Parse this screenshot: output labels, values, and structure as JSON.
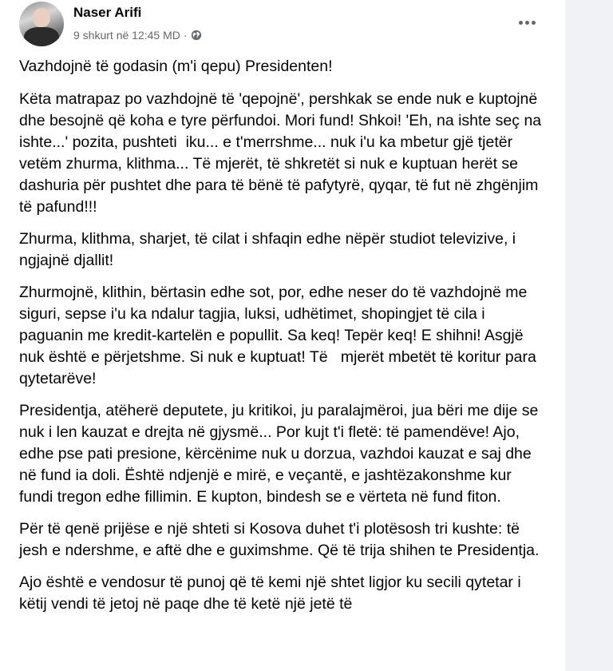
{
  "post": {
    "author": "Naser Arifi",
    "date": "9 shkurt në 12:45 MD",
    "separator": "·",
    "privacy_icon": "globe-icon",
    "more_icon": "more-options-icon",
    "paragraphs": [
      "Vazhdojnë të godasin (m'i qepu) Presidenten!",
      "Këta matrapaz po vazhdojnë të 'qepojnë', pershkak se ende nuk e kuptojnë dhe besojnë që koha e tyre përfundoi. Mori fund! Shkoi! 'Eh, na ishte seç na ishte...' pozita, pushteti  iku... e t'merrshme... nuk i'u ka mbetur gjë tjetër vetëm zhurma, klithma... Të mjerët, të shkretët si nuk e kuptuan herët se dashuria për pushtet dhe para të bënë të pafytyrë, qyqar, të fut në zhgënjim të pafund!!!",
      "Zhurma, klithma, sharjet, të cilat i shfaqin edhe nëpër studiot televizive, i ngjajnë djallit!",
      "Zhurmojnë, klithin, bërtasin edhe sot, por, edhe neser do të vazhdojnë me siguri, sepse i'u ka ndalur tagjia, luksi, udhëtimet, shopingjet të cila i paguanin me kredit-kartelën e popullit. Sa keq! Tepër keq! E shihni! Asgjë nuk është e përjetshme. Si nuk e kuptuat! Të   mjerët mbetët të koritur para qytetarëve!",
      "Presidentja, atëherë deputete, ju kritikoi, ju paralajmëroi, jua bëri me dije se nuk i len kauzat e drejta në gjysmë... Por kujt t'i fletë: të pamendëve! Ajo, edhe pse pati presione, kërcënime nuk u dorzua, vazhdoi kauzat e saj dhe në fund ia doli. Është ndjenjë e mirë, e veçantë, e jashtëzakonshme kur fundi tregon edhe fillimin. E kupton, bindesh se e vërteta në fund fiton.",
      "Për të qenë prijëse e një shteti si Kosova duhet t'i plotësosh tri kushte: të jesh e ndershme, e aftë dhe e guximshme. Që të trija shihen te Presidentja.",
      "Ajo është e vendosur të punoj që të kemi një shtet ligjor ku secili qytetar i këtij vendi të jetoj në paqe dhe të ketë një jetë të"
    ]
  }
}
